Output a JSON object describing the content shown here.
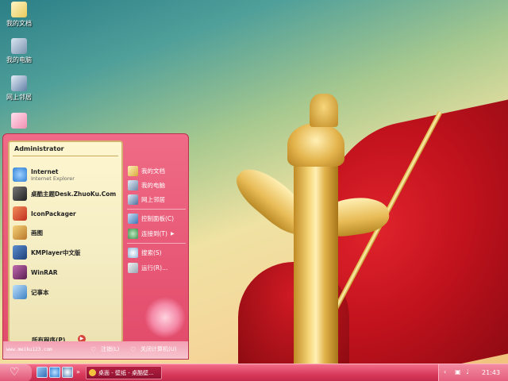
{
  "desktop": {
    "icons": [
      {
        "label": "我的文档",
        "icon": "my-documents-folder"
      },
      {
        "label": "我的电脑",
        "icon": "my-computer"
      },
      {
        "label": "网上邻居",
        "icon": "network-places"
      },
      {
        "label": "",
        "icon": "recycle-bin"
      }
    ]
  },
  "start_menu": {
    "user": "Administrator",
    "programs": [
      {
        "name": "Internet",
        "sub": "Internet Explorer",
        "icon": "internet-explorer",
        "color": "#2f7fd4"
      },
      {
        "name": "桌酷主题Desk.ZhuoKu.Com",
        "sub": "",
        "icon": "zhuoku-theme",
        "color": "#4a4a4a"
      },
      {
        "name": "IconPackager",
        "sub": "",
        "icon": "iconpackager",
        "color": "#d9482b"
      },
      {
        "name": "画图",
        "sub": "",
        "icon": "paint",
        "color": "#d8a437"
      },
      {
        "name": "KMPlayer中文版",
        "sub": "",
        "icon": "kmplayer",
        "color": "#2b5fa8"
      },
      {
        "name": "WinRAR",
        "sub": "",
        "icon": "winrar",
        "color": "#8c2f7a"
      },
      {
        "name": "记事本",
        "sub": "",
        "icon": "notepad",
        "color": "#5ca0d8"
      }
    ],
    "all_programs": "所有程序(P)",
    "right_items": [
      {
        "label": "我的文档",
        "icon": "my-documents"
      },
      {
        "label": "我的电脑",
        "icon": "my-computer"
      },
      {
        "label": "网上邻居",
        "icon": "network-places"
      },
      {
        "label": "控制面板(C)",
        "icon": "control-panel"
      },
      {
        "label": "连接到(T)",
        "icon": "connect-to"
      },
      {
        "label": "搜索(S)",
        "icon": "search"
      },
      {
        "label": "运行(R)...",
        "icon": "run"
      }
    ],
    "footer": {
      "site": "www.meiku123.com",
      "logoff": "注销(L)",
      "shutdown": "关闭计算机(U)"
    }
  },
  "taskbar": {
    "quick_launch": [
      "show-desktop",
      "internet-explorer",
      "media-player"
    ],
    "task_label": "桌面 - 壁纸 - 桌酷壁...",
    "clock": "21:43"
  },
  "colors": {
    "accent": "#e24a6a",
    "panel": "#fdf6cf",
    "taskbar": "#d93a5c"
  }
}
